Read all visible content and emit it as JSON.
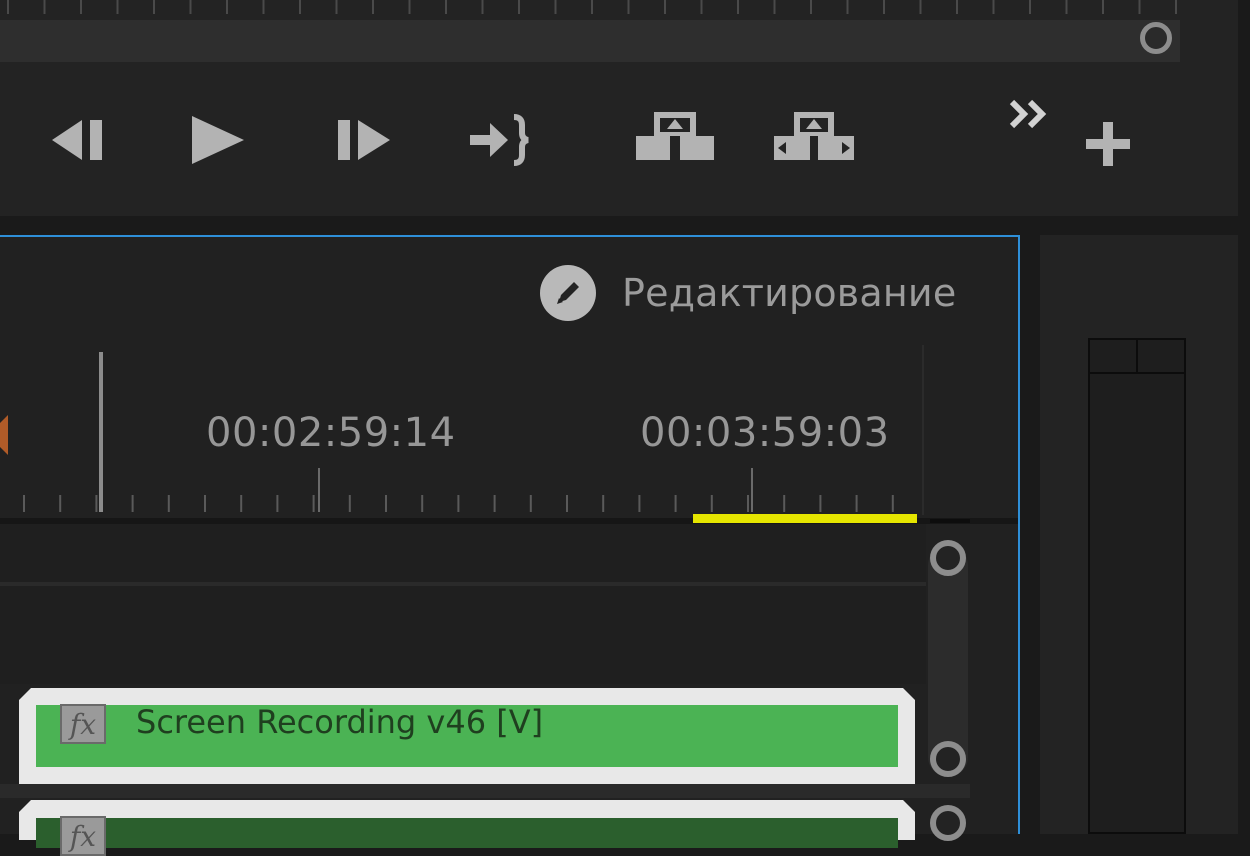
{
  "colors": {
    "accent_border": "#2e8fd8",
    "in_out_bar": "#e6e600",
    "clip_video": "#4bb354",
    "clip_video_dark": "#2b5f2d"
  },
  "transport": {
    "buttons": [
      {
        "name": "step-back-icon"
      },
      {
        "name": "play-icon"
      },
      {
        "name": "step-forward-icon"
      },
      {
        "name": "insert-icon"
      },
      {
        "name": "lift-icon"
      },
      {
        "name": "extract-icon"
      },
      {
        "name": "overflow-chevron-icon"
      },
      {
        "name": "add-button-icon"
      }
    ]
  },
  "timeline": {
    "workspace_icon": "pencil-icon",
    "workspace_label": "Редактирование",
    "timecodes": [
      "00:02:59:14",
      "00:03:59:03"
    ],
    "clips": [
      {
        "fx": "fx",
        "label": "Screen Recording v46 [V]"
      },
      {
        "fx": "fx",
        "label": ""
      }
    ]
  }
}
